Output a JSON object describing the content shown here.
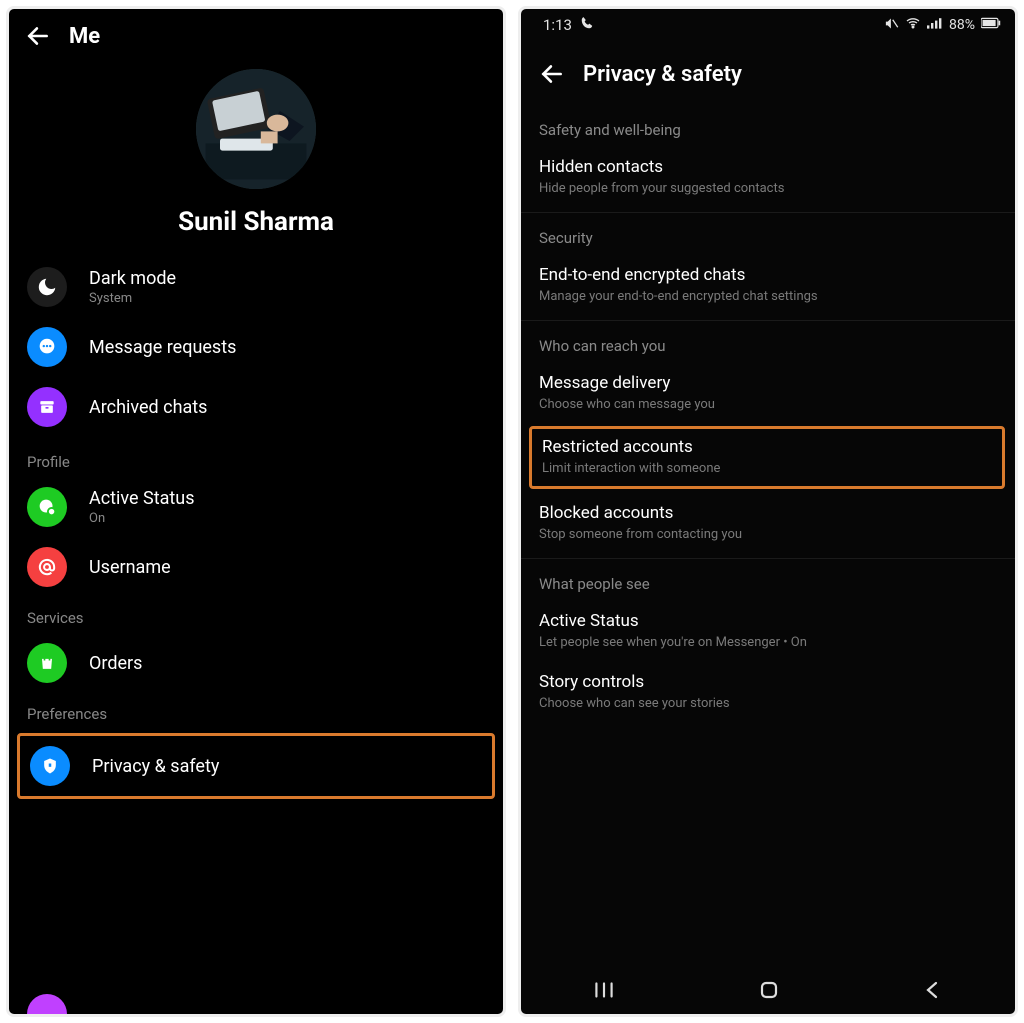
{
  "left": {
    "header_title": "Me",
    "profile_name": "Sunil Sharma",
    "rows": {
      "dark_mode": {
        "label": "Dark mode",
        "sub": "System"
      },
      "message_requests": {
        "label": "Message requests"
      },
      "archived_chats": {
        "label": "Archived chats"
      }
    },
    "sections": {
      "profile": "Profile",
      "services": "Services",
      "preferences": "Preferences"
    },
    "profile_rows": {
      "active_status": {
        "label": "Active Status",
        "sub": "On"
      },
      "username": {
        "label": "Username"
      }
    },
    "services_rows": {
      "orders": {
        "label": "Orders"
      }
    },
    "prefs_rows": {
      "privacy_safety": {
        "label": "Privacy & safety"
      }
    }
  },
  "right": {
    "status": {
      "time": "1:13",
      "battery": "88%"
    },
    "header_title": "Privacy & safety",
    "sections": {
      "safety": "Safety and well-being",
      "security": "Security",
      "reach": "Who can reach you",
      "people_see": "What people see"
    },
    "items": {
      "hidden_contacts": {
        "label": "Hidden contacts",
        "sub": "Hide people from your suggested contacts"
      },
      "e2e": {
        "label": "End-to-end encrypted chats",
        "sub": "Manage your end-to-end encrypted chat settings"
      },
      "message_delivery": {
        "label": "Message delivery",
        "sub": "Choose who can message you"
      },
      "restricted": {
        "label": "Restricted accounts",
        "sub": "Limit interaction with someone"
      },
      "blocked": {
        "label": "Blocked accounts",
        "sub": "Stop someone from contacting you"
      },
      "active_status": {
        "label": "Active Status",
        "sub": "Let people see when you're on Messenger • On"
      },
      "story_controls": {
        "label": "Story controls",
        "sub": "Choose who can see your stories"
      }
    }
  }
}
